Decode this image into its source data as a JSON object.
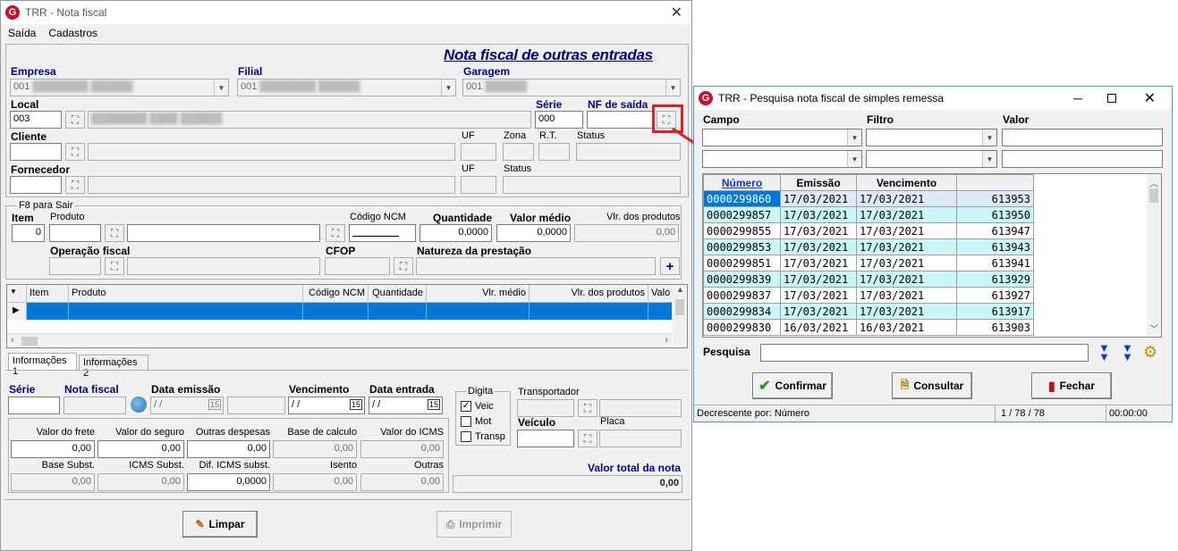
{
  "main": {
    "title": "TRR - Nota fiscal",
    "menu": [
      "Saída",
      "Cadastros"
    ],
    "header": "Nota fiscal de outras entradas",
    "empresa": {
      "label": "Empresa",
      "value": "001"
    },
    "filial": {
      "label": "Filial",
      "value": "001"
    },
    "garagem": {
      "label": "Garagem",
      "value": "001"
    },
    "local": {
      "label": "Local",
      "value": "003"
    },
    "serie": {
      "label": "Série",
      "value": "000"
    },
    "nf_saida": {
      "label": "NF de saída"
    },
    "cliente": {
      "label": "Cliente",
      "uf": "UF",
      "zona": "Zona",
      "rt": "R.T.",
      "status": "Status"
    },
    "fornecedor": {
      "label": "Fornecedor",
      "uf": "UF",
      "status": "Status"
    },
    "items": {
      "group": "F8 para Sair",
      "item_label": "Item",
      "item_value": "0",
      "produto": "Produto",
      "codigo_ncm": "Código NCM",
      "quantidade": "Quantidade",
      "quantidade_value": "0,0000",
      "valor_medio": "Valor médio",
      "valor_medio_value": "0,0000",
      "vlr_produtos": "Vlr. dos produtos",
      "vlr_produtos_value": "0,00",
      "operacao_fiscal": "Operação fiscal",
      "cfop": "CFOP",
      "natureza": "Natureza da prestação"
    },
    "grid_headers": [
      "Item",
      "Produto",
      "Código NCM",
      "Quantidade",
      "Vlr. médio",
      "Vlr. dos produtos",
      "Valo"
    ],
    "tabs": [
      "Informações 1",
      "Informações 2"
    ],
    "info": {
      "serie": "Série",
      "nota_fiscal": "Nota fiscal",
      "data_emissao": "Data emissão",
      "data_emissao_value": "/  /",
      "vencimento": "Vencimento",
      "vencimento_value": "/  /",
      "data_entrada": "Data entrada",
      "data_entrada_value": "/  /",
      "digita": "Digita",
      "veic": "Veic",
      "mot": "Mot",
      "transp": "Transp",
      "transportador": "Transportador",
      "veiculo": "Veículo",
      "placa": "Placa"
    },
    "totals": {
      "row1": [
        {
          "label": "Valor do frete",
          "value": "0,00"
        },
        {
          "label": "Valor do seguro",
          "value": "0,00"
        },
        {
          "label": "Outras despesas",
          "value": "0,00"
        },
        {
          "label": "Base de calculo",
          "value": "0,00"
        },
        {
          "label": "Valor do ICMS",
          "value": "0,00"
        }
      ],
      "row2": [
        {
          "label": "Base Subst.",
          "value": "0,00"
        },
        {
          "label": "ICMS Subst.",
          "value": "0,00"
        },
        {
          "label": "Dif. ICMS subst.",
          "value": "0,0000"
        },
        {
          "label": "Isento",
          "value": "0,00"
        },
        {
          "label": "Outras",
          "value": "0,00"
        }
      ],
      "valor_total_label": "Valor total da nota",
      "valor_total_value": "0,00"
    },
    "buttons": {
      "limpar": "Limpar",
      "imprimir": "Imprimir"
    }
  },
  "search": {
    "title": "TRR - Pesquisa nota fiscal de simples remessa",
    "campo": "Campo",
    "filtro": "Filtro",
    "valor": "Valor",
    "columns": [
      "Número",
      "Emissão",
      "Vencimento",
      ""
    ],
    "rows": [
      [
        "0000299860",
        "17/03/2021",
        "17/03/2021",
        "613953"
      ],
      [
        "0000299857",
        "17/03/2021",
        "17/03/2021",
        "613950"
      ],
      [
        "0000299855",
        "17/03/2021",
        "17/03/2021",
        "613947"
      ],
      [
        "0000299853",
        "17/03/2021",
        "17/03/2021",
        "613943"
      ],
      [
        "0000299851",
        "17/03/2021",
        "17/03/2021",
        "613941"
      ],
      [
        "0000299839",
        "17/03/2021",
        "17/03/2021",
        "613929"
      ],
      [
        "0000299837",
        "17/03/2021",
        "17/03/2021",
        "613927"
      ],
      [
        "0000299834",
        "17/03/2021",
        "17/03/2021",
        "613917"
      ],
      [
        "0000299830",
        "16/03/2021",
        "16/03/2021",
        "613903"
      ]
    ],
    "pesquisa": "Pesquisa",
    "buttons": {
      "confirmar": "Confirmar",
      "consultar": "Consultar",
      "fechar": "Fechar"
    },
    "status": {
      "order": "Decrescente por: Número",
      "count": "1 / 78 / 78",
      "time": "00:00:00"
    }
  },
  "colors": {
    "accent": "#0078d7",
    "highlight_red": "#e02020",
    "label_blue": "#000080"
  }
}
